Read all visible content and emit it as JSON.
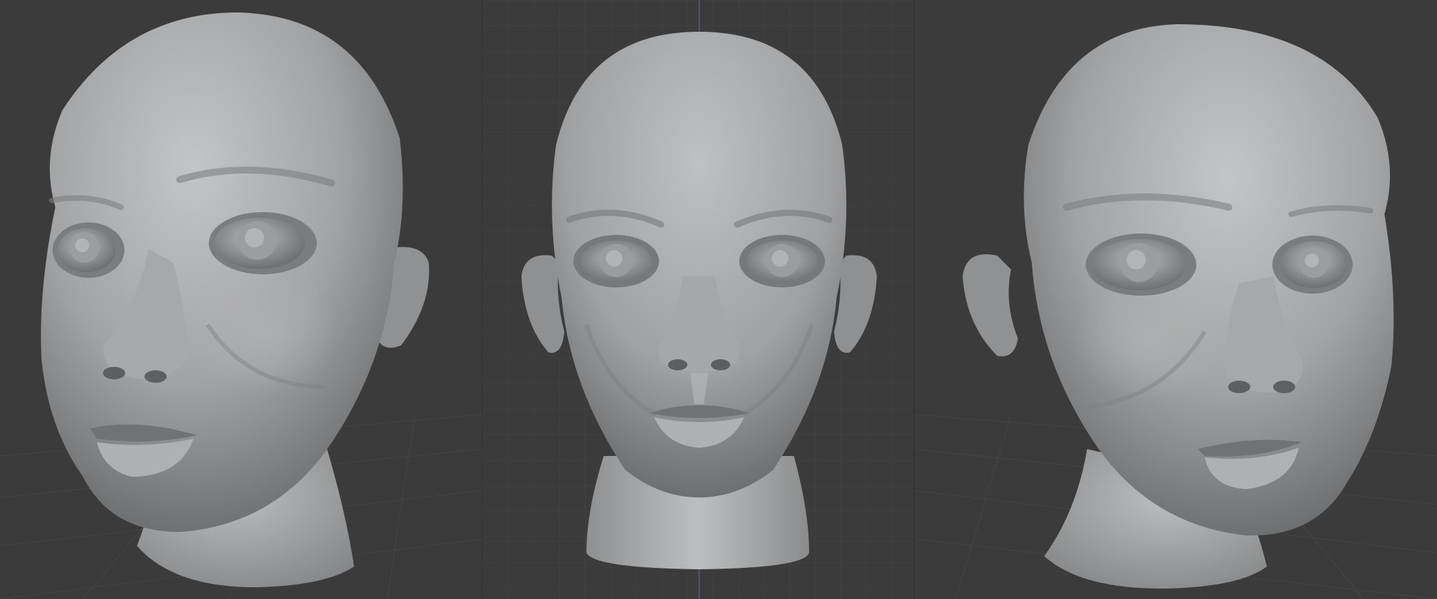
{
  "app": {
    "background_color": "#3b3b3b",
    "grid_color": "#464646",
    "axis_color": "#4a5a6e"
  },
  "viewports": [
    {
      "view": "perspective-left",
      "subject": "head-sculpt"
    },
    {
      "view": "front-orthographic",
      "subject": "head-sculpt"
    },
    {
      "view": "perspective-right",
      "subject": "head-sculpt"
    }
  ],
  "material": {
    "base_color": "#9a9b9c",
    "highlight_color": "#c6c7c8",
    "shadow_color": "#555758"
  }
}
